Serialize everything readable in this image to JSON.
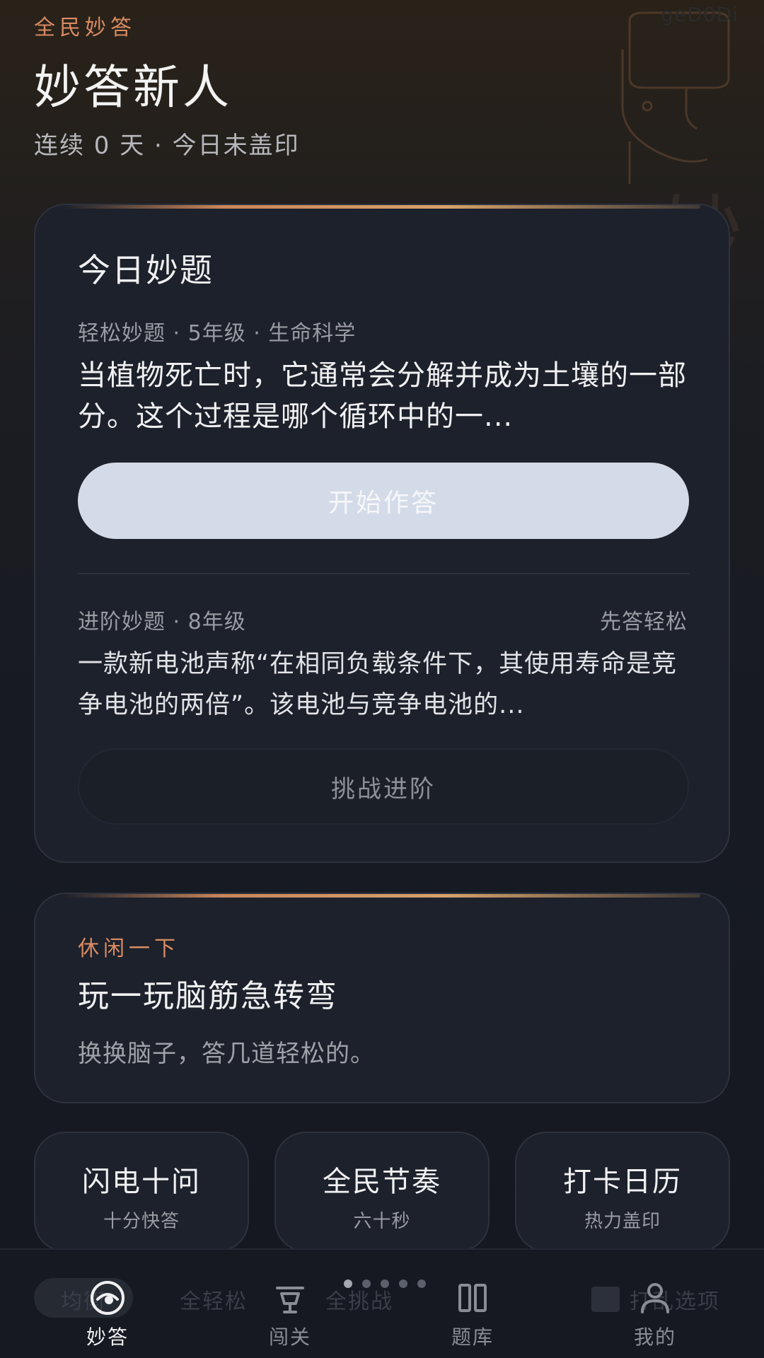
{
  "header": {
    "watermark": "geD0Di",
    "eyebrow": "全民妙答",
    "title": "妙答新人",
    "streak": "连续 0 天 · 今日未盖印",
    "deco_char": "妙"
  },
  "daily": {
    "title": "今日妙题",
    "easy": {
      "meta": "轻松妙题 · 5年级 · 生命科学",
      "question": "当植物死亡时，它通常会分解并成为土壤的一部分。这个过程是哪个循环中的一...",
      "button": "开始作答"
    },
    "advanced": {
      "meta": "进阶妙题 · 8年级",
      "hint": "先答轻松",
      "question": "一款新电池声称“在相同负载条件下，其使用寿命是竞争电池的两倍”。该电池与竞争电池的...",
      "button": "挑战进阶"
    }
  },
  "casual": {
    "eyebrow": "休闲一下",
    "title": "玩一玩脑筋急转弯",
    "desc": "换换脑子，答几道轻松的。"
  },
  "modes": [
    {
      "title": "闪电十问",
      "sub": "十分快答"
    },
    {
      "title": "全民节奏",
      "sub": "六十秒"
    },
    {
      "title": "打卡日历",
      "sub": "热力盖印"
    }
  ],
  "filters": {
    "pill": "均衡",
    "f1": "全轻松",
    "f2": "全挑战",
    "f3": "打乱选项"
  },
  "pager": {
    "count": 5,
    "active_index": 0
  },
  "nav": [
    {
      "label": "妙答",
      "icon": "eye-icon",
      "active": true
    },
    {
      "label": "闯关",
      "icon": "trophy-icon",
      "active": false
    },
    {
      "label": "题库",
      "icon": "book-icon",
      "active": false
    },
    {
      "label": "我的",
      "icon": "person-icon",
      "active": false
    }
  ],
  "colors": {
    "accent": "#d98b62",
    "card_bg": "#1d212b",
    "primary_button": "#d4dbe8"
  }
}
